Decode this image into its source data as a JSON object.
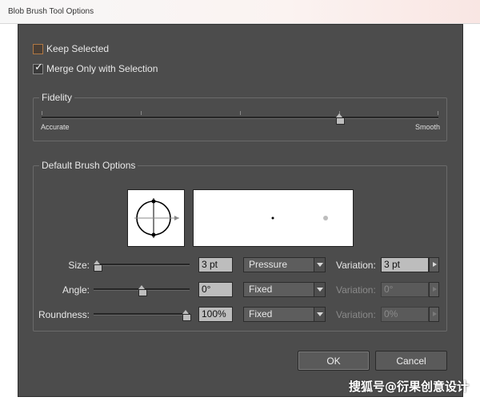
{
  "window": {
    "title": "Blob Brush Tool Options"
  },
  "options": {
    "keep_selected": {
      "label": "Keep Selected",
      "checked": false
    },
    "merge_only": {
      "label": "Merge Only with Selection",
      "checked": true
    }
  },
  "fidelity": {
    "title": "Fidelity",
    "min_label": "Accurate",
    "max_label": "Smooth",
    "value_fraction": 0.75
  },
  "brush": {
    "title": "Default Brush Options",
    "rows": [
      {
        "label": "Size:",
        "value": "3 pt",
        "mode": "Pressure",
        "variation_label": "Variation:",
        "variation": "3 pt",
        "variation_enabled": true,
        "slider_fraction": 0.0
      },
      {
        "label": "Angle:",
        "value": "0°",
        "mode": "Fixed",
        "variation_label": "Variation:",
        "variation": "0°",
        "variation_enabled": false,
        "slider_fraction": 0.5
      },
      {
        "label": "Roundness:",
        "value": "100%",
        "mode": "Fixed",
        "variation_label": "Variation:",
        "variation": "0%",
        "variation_enabled": false,
        "slider_fraction": 1.0
      }
    ]
  },
  "buttons": {
    "ok": "OK",
    "cancel": "Cancel"
  },
  "watermark": "搜狐号@衍果创意设计",
  "colors": {
    "dialog_bg": "#4c4c4c",
    "field_bg": "#bdbdbd",
    "checkbox_accent": "#b07844"
  }
}
